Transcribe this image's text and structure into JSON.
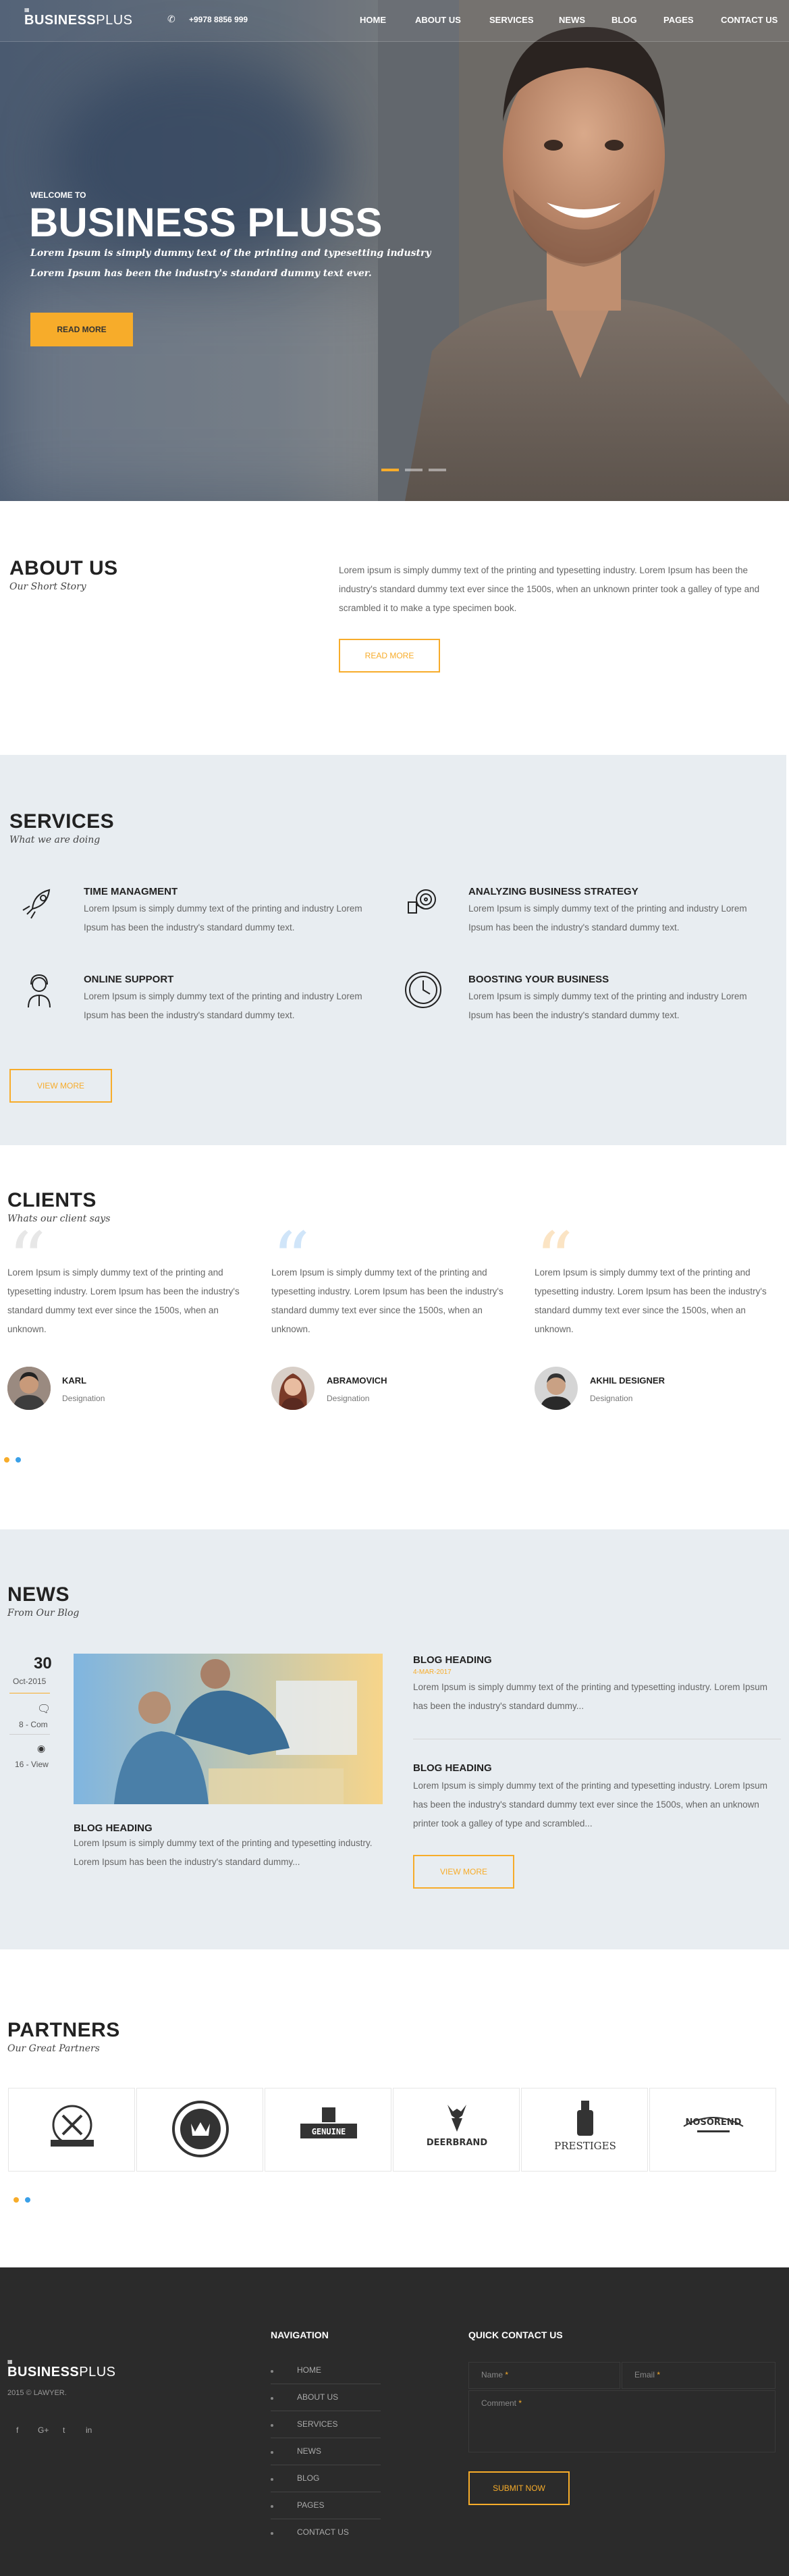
{
  "header": {
    "logo_main": "BUSINESS",
    "logo_thin": "PLUS",
    "phone": "+9978 8856 999",
    "nav": [
      "HOME",
      "ABOUT US",
      "SERVICES",
      "NEWS",
      "BLOG",
      "PAGES",
      "CONTACT US"
    ]
  },
  "hero": {
    "welcome": "WELCOME TO",
    "title": "BUSINESS PLUSS",
    "line1": "Lorem Ipsum is simply dummy text of the printing and typesetting industry",
    "line2": "Lorem Ipsum has been the industry's standard dummy text ever.",
    "button": "READ MORE"
  },
  "about": {
    "title": "ABOUT US",
    "subtitle": "Our Short Story",
    "text": "Lorem ipsum is simply dummy text of the printing and typesetting industry. Lorem Ipsum has been the industry's standard dummy text ever since the 1500s, when an unknown printer took a galley of type and scrambled it to make a type specimen book.",
    "button": "READ MORE"
  },
  "services": {
    "title": "SERVICES",
    "subtitle": "What we are doing",
    "items": [
      {
        "title": "TIME MANAGMENT",
        "text": "Lorem Ipsum is simply dummy text of the printing and industry Lorem Ipsum has been the industry's standard dummy text.",
        "icon": "rocket-icon"
      },
      {
        "title": "ANALYZING BUSINESS STRATEGY",
        "text": "Lorem Ipsum is simply dummy text of the printing and industry Lorem Ipsum has been the industry's standard dummy text.",
        "icon": "strategy-icon"
      },
      {
        "title": "ONLINE SUPPORT",
        "text": "Lorem Ipsum is simply dummy text of the printing and industry Lorem Ipsum has been the industry's standard dummy text.",
        "icon": "support-icon"
      },
      {
        "title": "BOOSTING YOUR BUSINESS",
        "text": "Lorem Ipsum is simply dummy text of the printing and industry Lorem Ipsum has been the industry's standard dummy text.",
        "icon": "clock-icon"
      }
    ],
    "button": "VIEW MORE"
  },
  "clients": {
    "title": "CLIENTS",
    "subtitle": "Whats our client says",
    "items": [
      {
        "quote": "Lorem Ipsum is simply dummy text of the printing and typesetting industry. Lorem Ipsum has been the industry's standard dummy text ever since the 1500s, when an unknown.",
        "name": "KARL",
        "designation": "Designation",
        "color": "#cfcfcf"
      },
      {
        "quote": "Lorem Ipsum is simply dummy text of the printing and typesetting industry. Lorem Ipsum has been the industry's standard dummy text ever since the 1500s, when an unknown.",
        "name": "ABRAMOVICH",
        "designation": "Designation",
        "color": "#9fc8ee"
      },
      {
        "quote": "Lorem Ipsum is simply dummy text of the printing and typesetting industry. Lorem Ipsum has been the industry's standard dummy text ever since the 1500s, when an unknown.",
        "name": "AKHIL DESIGNER",
        "designation": "Designation",
        "color": "#f7c37a"
      }
    ]
  },
  "news": {
    "title": "NEWS",
    "subtitle": "From Our Blog",
    "day": "30",
    "month": "Oct-2015",
    "comments": "8 - Com",
    "views": "16 - View",
    "featured_heading": "BLOG HEADING",
    "featured_text": "Lorem Ipsum is simply dummy text of the printing and typesetting industry. Lorem Ipsum has been the industry's standard dummy...",
    "posts": [
      {
        "heading": "BLOG HEADING",
        "date": "4-MAR-2017",
        "text": "Lorem Ipsum is simply dummy text of the printing and typesetting industry. Lorem Ipsum has been the industry's standard dummy..."
      },
      {
        "heading": "BLOG HEADING",
        "date": "",
        "text": "Lorem Ipsum is simply dummy text of the printing and typesetting industry. Lorem Ipsum has been the industry's standard dummy text ever since the 1500s, when an unknown printer took a galley of type and scrambled..."
      }
    ],
    "button": "VIEW MORE"
  },
  "partners": {
    "title": "PARTNERS",
    "subtitle": "Our Great Partners",
    "logos": [
      "",
      "",
      "GENUINE",
      "DEERBRAND",
      "PRESTIGES",
      "NOSOREND"
    ]
  },
  "footer": {
    "logo_main": "BUSINESS",
    "logo_thin": "PLUS",
    "copyright": "2015 © LAWYER.",
    "nav_title": "NAVIGATION",
    "nav": [
      "HOME",
      "ABOUT US",
      "SERVICES",
      "NEWS",
      "BLOG",
      "PAGES",
      "CONTACT US"
    ],
    "contact_title": "QUICK CONTACT US",
    "name_placeholder": "Name",
    "email_placeholder": "Email",
    "comment_placeholder": "Comment",
    "submit": "SUBMIT NOW",
    "social": [
      "f",
      "G+",
      "t",
      "in"
    ]
  },
  "colors": {
    "accent": "#f7ac2a",
    "blue": "#3aa0e8",
    "footer": "#2b2b2b"
  }
}
